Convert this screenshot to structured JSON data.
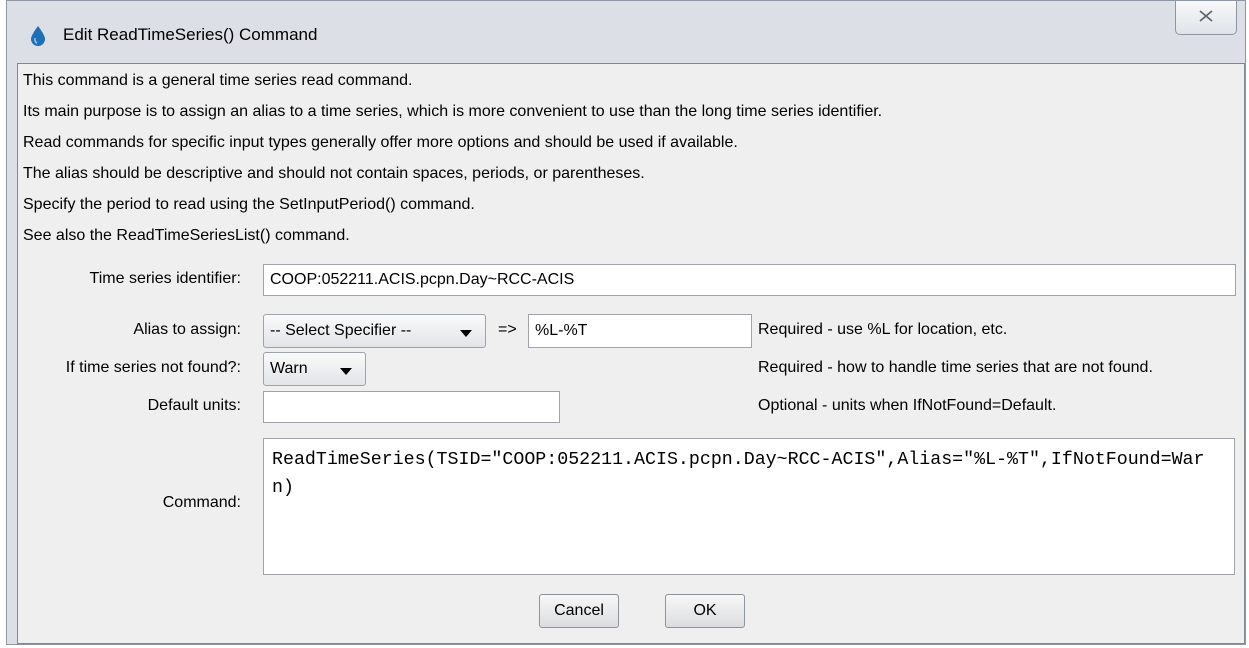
{
  "window": {
    "title": "Edit ReadTimeSeries() Command",
    "close_icon": "close-icon",
    "app_icon": "water-drop-icon"
  },
  "info_lines": [
    "This command is a general time series read command.",
    "Its main purpose is to assign an alias to a time series, which is more convenient to use than the long time series identifier.",
    "Read commands for specific input types generally offer more options and should be used if available.",
    "The alias should be descriptive and should not contain spaces, periods, or parentheses.",
    "Specify the period to read using the SetInputPeriod() command.",
    "See also the ReadTimeSeriesList() command."
  ],
  "form": {
    "tsid": {
      "label": "Time series identifier:",
      "value": "COOP:052211.ACIS.pcpn.Day~RCC-ACIS"
    },
    "alias": {
      "label": "Alias to assign:",
      "specifier_selected": "-- Select Specifier --",
      "arrow_text": "=>",
      "value": "%L-%T",
      "note": "Required - use %L for location, etc."
    },
    "if_not_found": {
      "label": "If time series not found?:",
      "selected": "Warn",
      "note": "Required - how to handle time series that are not found."
    },
    "default_units": {
      "label": "Default units:",
      "value": "",
      "note": "Optional - units when IfNotFound=Default."
    },
    "command": {
      "label": "Command:",
      "value": "ReadTimeSeries(TSID=\"COOP:052211.ACIS.pcpn.Day~RCC-ACIS\",Alias=\"%L-%T\",IfNotFound=Warn)"
    }
  },
  "buttons": {
    "cancel": "Cancel",
    "ok": "OK"
  },
  "colors": {
    "drop_icon": "#1f6fb8",
    "window_frame": "#dcdfe5",
    "panel": "#efefef"
  }
}
